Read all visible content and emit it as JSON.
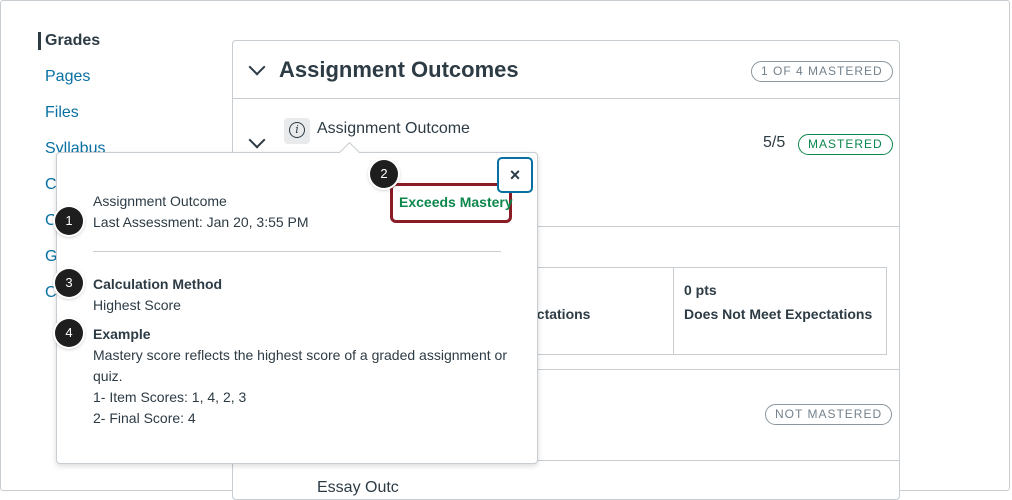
{
  "nav": {
    "items": [
      {
        "label": "Grades",
        "active": true
      },
      {
        "label": "Pages"
      },
      {
        "label": "Files"
      },
      {
        "label": "Syllabus"
      },
      {
        "label": "C"
      },
      {
        "label": "C"
      },
      {
        "label": "G"
      },
      {
        "label": "C"
      }
    ]
  },
  "panel": {
    "title": "Assignment Outcomes",
    "mastered_count": "1 OF 4 MASTERED",
    "outcome": {
      "name": "Assignment Outcome",
      "score": "5/5",
      "status": "MASTERED"
    },
    "rubric": [
      {
        "points": "",
        "description": "ectations"
      },
      {
        "points": "0 pts",
        "description": "Does Not Meet Expectations"
      }
    ],
    "second_status": "NOT MASTERED",
    "row4_text": "Essay Outc"
  },
  "popover": {
    "outcome_name": "Assignment Outcome",
    "last_assessment": "Last Assessment: Jan 20, 3:55 PM",
    "mastery_label": "Exceeds Mastery",
    "close": "×",
    "calc_heading": "Calculation Method",
    "calc_value": "Highest Score",
    "example_heading": "Example",
    "example_line1": "Mastery score reflects the highest score of a graded assignment or",
    "example_line2": "quiz.",
    "example_line3": "1- Item Scores: 1, 4, 2, 3",
    "example_line4": "2- Final Score: 4"
  },
  "callouts": [
    "1",
    "2",
    "3",
    "4"
  ],
  "colors": {
    "link": "#0770a3",
    "mastered_green": "#0b874b",
    "highlight_red": "#8a1c26",
    "text": "#2d3b45"
  }
}
